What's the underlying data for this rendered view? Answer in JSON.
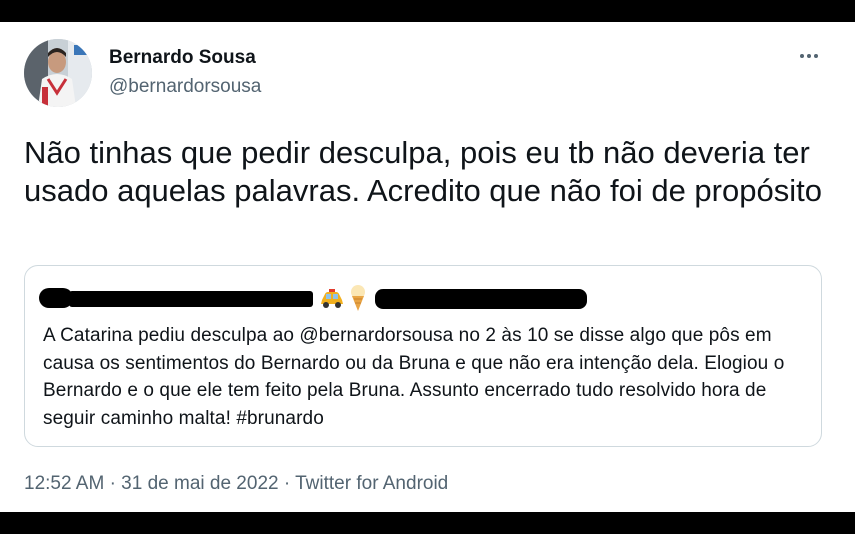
{
  "author": {
    "name": "Bernardo Sousa",
    "handle": "@bernardorsousa"
  },
  "tweet": {
    "text": "Não tinhas que pedir desculpa, pois eu tb não deveria ter usado aquelas palavras. Acredito que não foi de propósito"
  },
  "quoted_tweet": {
    "author_redacted": true,
    "emoji": [
      "taxi-emoji",
      "ice-cream-emoji"
    ],
    "text": "A Catarina pediu desculpa ao @bernardorsousa no 2 às 10 se disse algo que pôs em causa os sentimentos do Bernardo ou da Bruna e que não era intenção dela. Elogiou o Bernardo e o que ele tem feito pela Bruna. Assunto encerrado tudo resolvido hora de seguir caminho malta! #brunardo"
  },
  "meta": {
    "time": "12:52 AM",
    "separator": "·",
    "date": "31 de mai de 2022",
    "source": "Twitter for Android"
  },
  "colors": {
    "text_primary": "#0f1419",
    "text_secondary": "#536471",
    "border": "#cfd9de"
  }
}
